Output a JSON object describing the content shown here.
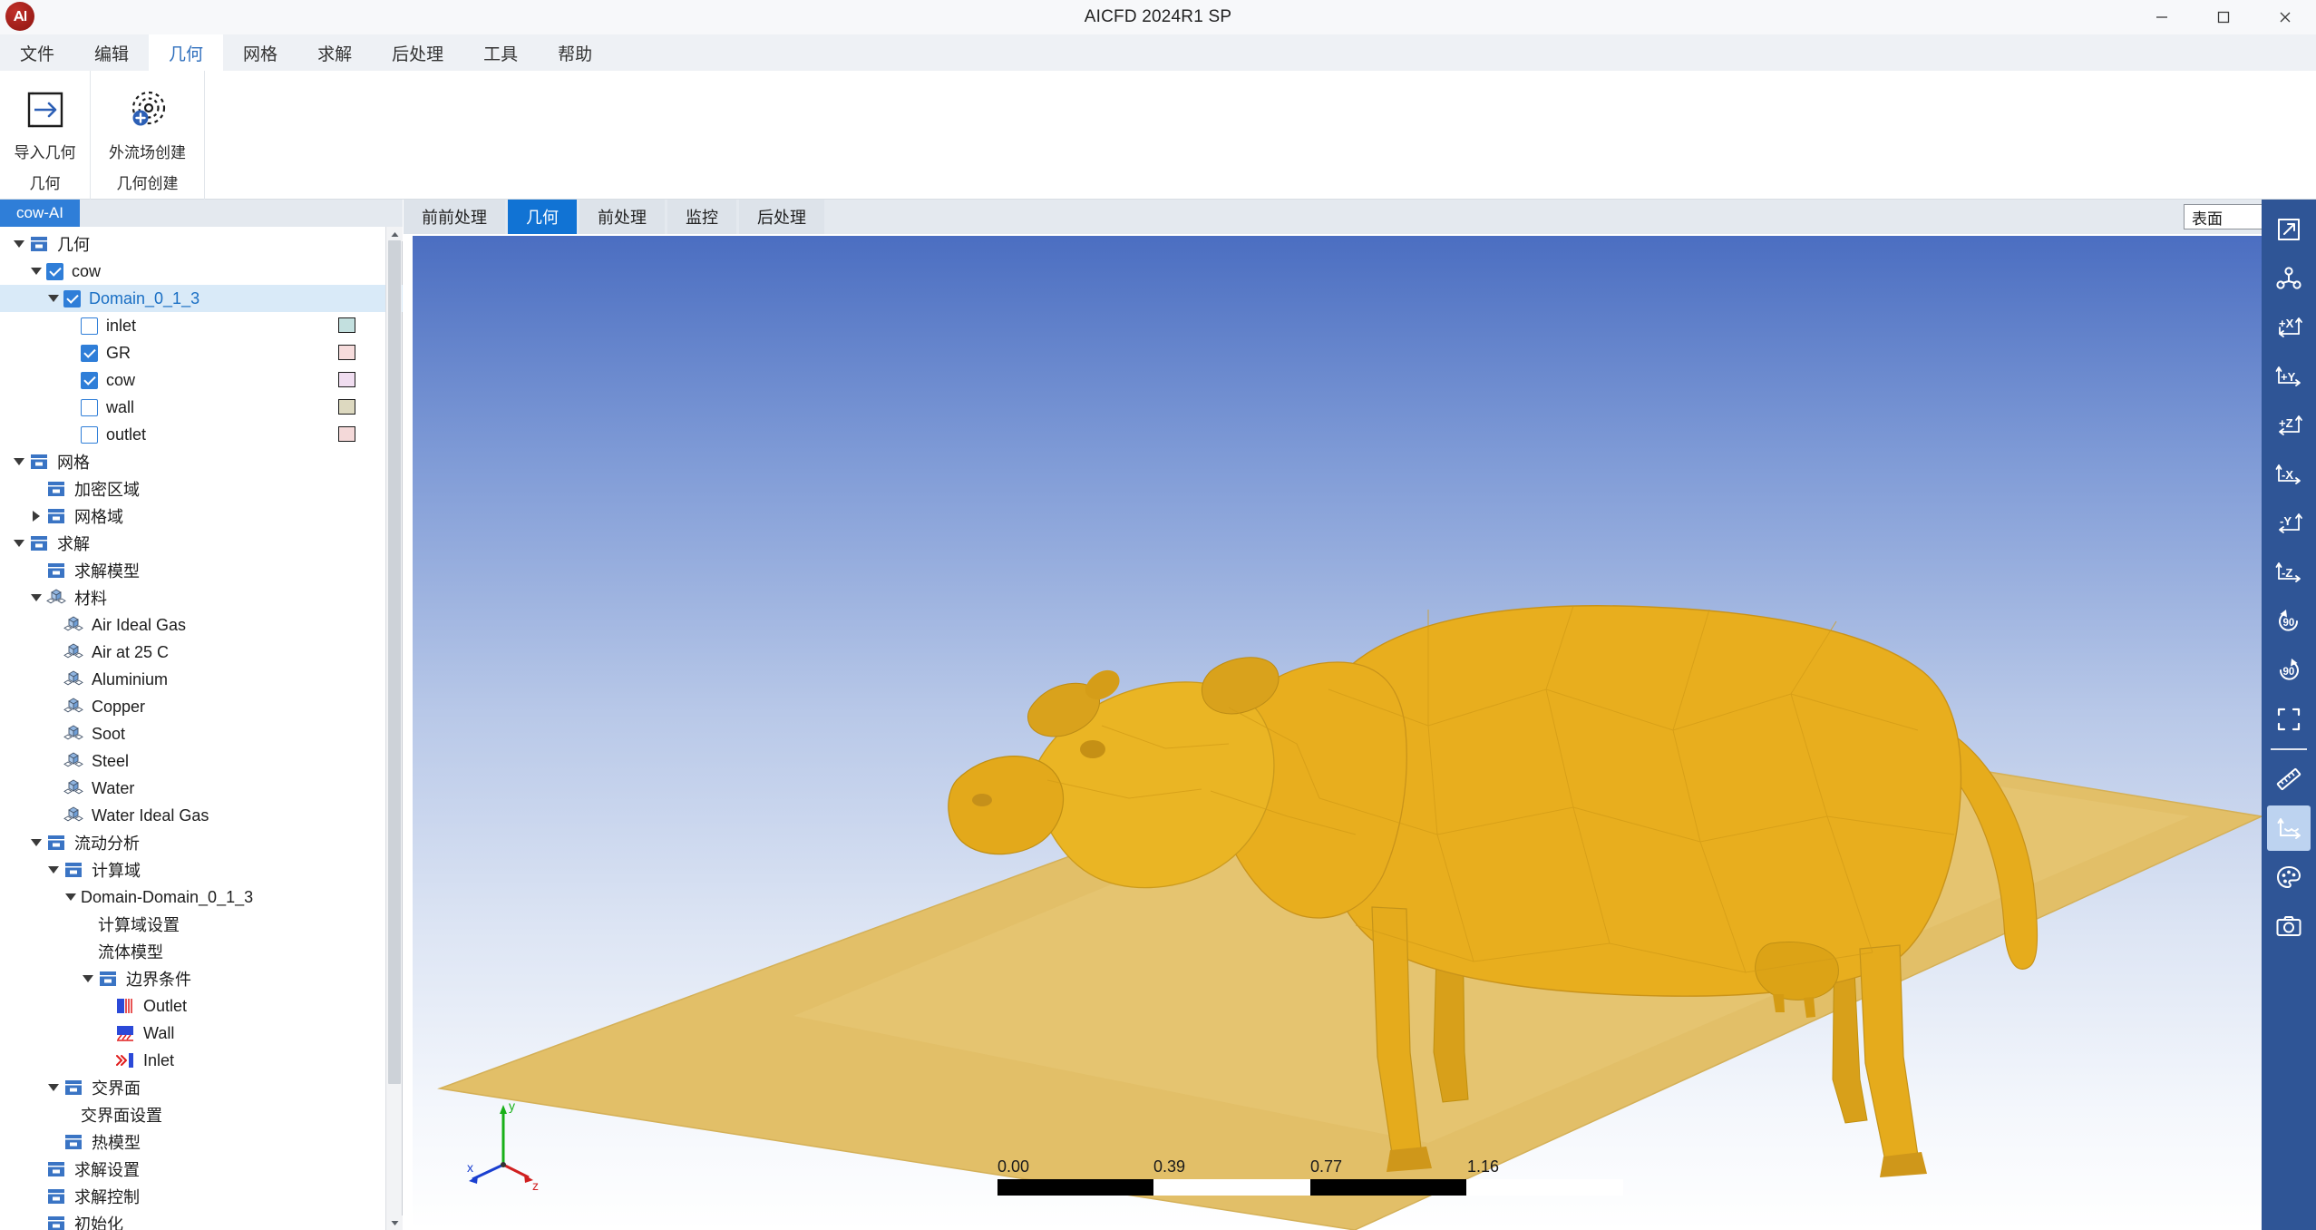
{
  "window": {
    "title": "AICFD 2024R1 SP",
    "logo_name": "aicfd-logo",
    "minimize": "−",
    "maximize": "▢",
    "close": "✕"
  },
  "menubar": {
    "items": [
      {
        "label": "文件",
        "active": false
      },
      {
        "label": "编辑",
        "active": false
      },
      {
        "label": "几何",
        "active": true
      },
      {
        "label": "网格",
        "active": false
      },
      {
        "label": "求解",
        "active": false
      },
      {
        "label": "后处理",
        "active": false
      },
      {
        "label": "工具",
        "active": false
      },
      {
        "label": "帮助",
        "active": false
      }
    ]
  },
  "ribbon": {
    "groups": [
      {
        "id": "geom",
        "group_label": "几何",
        "button_label": "导入几何",
        "icon": "import-geometry-icon"
      },
      {
        "id": "geomcreate",
        "group_label": "几何创建",
        "button_label": "外流场创建",
        "icon": "external-flow-field-icon"
      }
    ]
  },
  "left_panel": {
    "project_tab": "cow-AI",
    "tree": [
      {
        "depth": 0,
        "twist": "open",
        "icon": "folder-blue-icon",
        "label": "几何",
        "check": null,
        "swatch": null,
        "selected": false
      },
      {
        "depth": 1,
        "twist": "open",
        "icon": null,
        "label": "cow",
        "check": true,
        "swatch": null,
        "selected": false
      },
      {
        "depth": 2,
        "twist": "open",
        "icon": null,
        "label": "Domain_0_1_3",
        "check": true,
        "swatch": null,
        "selected": true
      },
      {
        "depth": 3,
        "twist": "none",
        "icon": null,
        "label": "inlet",
        "check": false,
        "swatch": "#c3e0df",
        "selected": false
      },
      {
        "depth": 3,
        "twist": "none",
        "icon": null,
        "label": "GR",
        "check": true,
        "swatch": "#f6dcdc",
        "selected": false
      },
      {
        "depth": 3,
        "twist": "none",
        "icon": null,
        "label": "cow",
        "check": true,
        "swatch": "#f0ddf0",
        "selected": false
      },
      {
        "depth": 3,
        "twist": "none",
        "icon": null,
        "label": "wall",
        "check": false,
        "swatch": "#ddd9c0",
        "selected": false
      },
      {
        "depth": 3,
        "twist": "none",
        "icon": null,
        "label": "outlet",
        "check": false,
        "swatch": "#f4d9d9",
        "selected": false
      },
      {
        "depth": 0,
        "twist": "open",
        "icon": "folder-blue-icon",
        "label": "网格",
        "check": null,
        "swatch": null,
        "selected": false
      },
      {
        "depth": 1,
        "twist": "none",
        "icon": "folder-blue-icon",
        "label": "加密区域",
        "check": null,
        "swatch": null,
        "selected": false
      },
      {
        "depth": 1,
        "twist": "closed",
        "icon": "folder-blue-icon",
        "label": "网格域",
        "check": null,
        "swatch": null,
        "selected": false
      },
      {
        "depth": 0,
        "twist": "open",
        "icon": "folder-blue-icon",
        "label": "求解",
        "check": null,
        "swatch": null,
        "selected": false
      },
      {
        "depth": 1,
        "twist": "none",
        "icon": "folder-blue-icon",
        "label": "求解模型",
        "check": null,
        "swatch": null,
        "selected": false
      },
      {
        "depth": 1,
        "twist": "open",
        "icon": "material-icon",
        "label": "材料",
        "check": null,
        "swatch": null,
        "selected": false
      },
      {
        "depth": 2,
        "twist": "none",
        "icon": "material-icon",
        "label": "Air Ideal Gas",
        "check": null,
        "swatch": null,
        "selected": false
      },
      {
        "depth": 2,
        "twist": "none",
        "icon": "material-icon",
        "label": "Air at 25 C",
        "check": null,
        "swatch": null,
        "selected": false
      },
      {
        "depth": 2,
        "twist": "none",
        "icon": "material-icon",
        "label": "Aluminium",
        "check": null,
        "swatch": null,
        "selected": false
      },
      {
        "depth": 2,
        "twist": "none",
        "icon": "material-icon",
        "label": "Copper",
        "check": null,
        "swatch": null,
        "selected": false
      },
      {
        "depth": 2,
        "twist": "none",
        "icon": "material-icon",
        "label": "Soot",
        "check": null,
        "swatch": null,
        "selected": false
      },
      {
        "depth": 2,
        "twist": "none",
        "icon": "material-icon",
        "label": "Steel",
        "check": null,
        "swatch": null,
        "selected": false
      },
      {
        "depth": 2,
        "twist": "none",
        "icon": "material-icon",
        "label": "Water",
        "check": null,
        "swatch": null,
        "selected": false
      },
      {
        "depth": 2,
        "twist": "none",
        "icon": "material-icon",
        "label": "Water Ideal Gas",
        "check": null,
        "swatch": null,
        "selected": false
      },
      {
        "depth": 1,
        "twist": "open",
        "icon": "folder-blue-icon",
        "label": "流动分析",
        "check": null,
        "swatch": null,
        "selected": false
      },
      {
        "depth": 2,
        "twist": "open",
        "icon": "folder-blue-icon",
        "label": "计算域",
        "check": null,
        "swatch": null,
        "selected": false
      },
      {
        "depth": 3,
        "twist": "open",
        "icon": null,
        "label": "Domain-Domain_0_1_3",
        "check": null,
        "swatch": null,
        "selected": false
      },
      {
        "depth": 4,
        "twist": "none",
        "icon": null,
        "label": "计算域设置",
        "check": null,
        "swatch": null,
        "selected": false
      },
      {
        "depth": 4,
        "twist": "none",
        "icon": null,
        "label": "流体模型",
        "check": null,
        "swatch": null,
        "selected": false
      },
      {
        "depth": 4,
        "twist": "open",
        "icon": "folder-blue-icon",
        "label": "边界条件",
        "check": null,
        "swatch": null,
        "selected": false
      },
      {
        "depth": 5,
        "twist": "none",
        "icon": "outlet-icon",
        "label": "Outlet",
        "check": null,
        "swatch": null,
        "selected": false
      },
      {
        "depth": 5,
        "twist": "none",
        "icon": "wall-icon",
        "label": "Wall",
        "check": null,
        "swatch": null,
        "selected": false
      },
      {
        "depth": 5,
        "twist": "none",
        "icon": "inlet-icon",
        "label": "Inlet",
        "check": null,
        "swatch": null,
        "selected": false
      },
      {
        "depth": 2,
        "twist": "open",
        "icon": "folder-blue-icon",
        "label": "交界面",
        "check": null,
        "swatch": null,
        "selected": false
      },
      {
        "depth": 3,
        "twist": "none",
        "icon": null,
        "label": "交界面设置",
        "check": null,
        "swatch": null,
        "selected": false
      },
      {
        "depth": 2,
        "twist": "none",
        "icon": "folder-blue-icon",
        "label": "热模型",
        "check": null,
        "swatch": null,
        "selected": false
      },
      {
        "depth": 1,
        "twist": "none",
        "icon": "folder-blue-icon",
        "label": "求解设置",
        "check": null,
        "swatch": null,
        "selected": false
      },
      {
        "depth": 1,
        "twist": "none",
        "icon": "folder-blue-icon",
        "label": "求解控制",
        "check": null,
        "swatch": null,
        "selected": false
      },
      {
        "depth": 1,
        "twist": "none",
        "icon": "folder-blue-icon",
        "label": "初始化",
        "check": null,
        "swatch": null,
        "selected": false
      }
    ]
  },
  "view_tabs": {
    "items": [
      {
        "label": "前前处理",
        "active": false
      },
      {
        "label": "几何",
        "active": true
      },
      {
        "label": "前处理",
        "active": false
      },
      {
        "label": "监控",
        "active": false
      },
      {
        "label": "后处理",
        "active": false
      }
    ],
    "display_mode": "表面"
  },
  "viewport": {
    "model_name": "cow",
    "model_color": "#e8ae1e",
    "ground_color": "#e3c06a",
    "sky_top": "#4b6ec1",
    "sky_bottom": "#ffffff",
    "triad": {
      "x_label": "x",
      "y_label": "y",
      "z_label": "z",
      "x_color": "#1a3fd0",
      "y_color": "#18b018",
      "z_color": "#d02020"
    },
    "scale_bar": {
      "ticks": [
        "0.00",
        "0.39",
        "0.77",
        "1.16"
      ],
      "segments": 2
    }
  },
  "right_toolbar": {
    "items": [
      {
        "icon": "fit-view-icon",
        "active": false
      },
      {
        "icon": "pivot-point-icon",
        "active": false
      },
      {
        "icon": "view-plus-x-icon",
        "active": false,
        "label": "+X"
      },
      {
        "icon": "view-plus-y-icon",
        "active": false,
        "label": "+Y"
      },
      {
        "icon": "view-plus-z-icon",
        "active": false,
        "label": "+Z"
      },
      {
        "icon": "view-minus-x-icon",
        "active": false,
        "label": "-X"
      },
      {
        "icon": "view-minus-y-icon",
        "active": false,
        "label": "-Y"
      },
      {
        "icon": "view-minus-z-icon",
        "active": false,
        "label": "-Z"
      },
      {
        "icon": "rotate-ccw-90-icon",
        "active": false,
        "label": "90"
      },
      {
        "icon": "rotate-cw-90-icon",
        "active": false,
        "label": "90"
      },
      {
        "icon": "zoom-to-box-icon",
        "active": false
      },
      {
        "divider": true
      },
      {
        "icon": "ruler-icon",
        "active": false
      },
      {
        "icon": "toggle-axes-icon",
        "active": true
      },
      {
        "icon": "palette-icon",
        "active": false
      },
      {
        "icon": "camera-icon",
        "active": false
      }
    ]
  }
}
